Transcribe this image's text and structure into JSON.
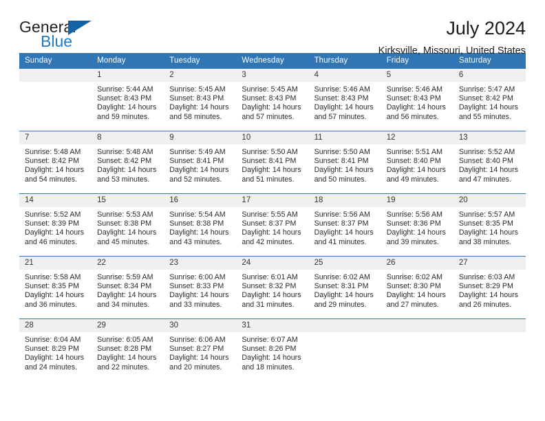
{
  "brand": {
    "name_part1": "General",
    "name_part2": "Blue",
    "accent_color": "#1e7bc4",
    "triangle_color": "#1464a5"
  },
  "header": {
    "title": "July 2024",
    "subtitle": "Kirksville, Missouri, United States"
  },
  "calendar": {
    "header_bg": "#3075b4",
    "daynum_bg": "#f0f0f0",
    "weekday_headers": [
      "Sunday",
      "Monday",
      "Tuesday",
      "Wednesday",
      "Thursday",
      "Friday",
      "Saturday"
    ],
    "labels": {
      "sunrise": "Sunrise:",
      "sunset": "Sunset:",
      "daylight": "Daylight:"
    },
    "weeks": [
      [
        {
          "day": "",
          "blank": true,
          "sunrise": "",
          "sunset": "",
          "daylight_line1": "",
          "daylight_line2": ""
        },
        {
          "day": "1",
          "sunrise": "Sunrise: 5:44 AM",
          "sunset": "Sunset: 8:43 PM",
          "daylight_line1": "Daylight: 14 hours",
          "daylight_line2": "and 59 minutes."
        },
        {
          "day": "2",
          "sunrise": "Sunrise: 5:45 AM",
          "sunset": "Sunset: 8:43 PM",
          "daylight_line1": "Daylight: 14 hours",
          "daylight_line2": "and 58 minutes."
        },
        {
          "day": "3",
          "sunrise": "Sunrise: 5:45 AM",
          "sunset": "Sunset: 8:43 PM",
          "daylight_line1": "Daylight: 14 hours",
          "daylight_line2": "and 57 minutes."
        },
        {
          "day": "4",
          "sunrise": "Sunrise: 5:46 AM",
          "sunset": "Sunset: 8:43 PM",
          "daylight_line1": "Daylight: 14 hours",
          "daylight_line2": "and 57 minutes."
        },
        {
          "day": "5",
          "sunrise": "Sunrise: 5:46 AM",
          "sunset": "Sunset: 8:43 PM",
          "daylight_line1": "Daylight: 14 hours",
          "daylight_line2": "and 56 minutes."
        },
        {
          "day": "6",
          "sunrise": "Sunrise: 5:47 AM",
          "sunset": "Sunset: 8:42 PM",
          "daylight_line1": "Daylight: 14 hours",
          "daylight_line2": "and 55 minutes."
        }
      ],
      [
        {
          "day": "7",
          "sunrise": "Sunrise: 5:48 AM",
          "sunset": "Sunset: 8:42 PM",
          "daylight_line1": "Daylight: 14 hours",
          "daylight_line2": "and 54 minutes."
        },
        {
          "day": "8",
          "sunrise": "Sunrise: 5:48 AM",
          "sunset": "Sunset: 8:42 PM",
          "daylight_line1": "Daylight: 14 hours",
          "daylight_line2": "and 53 minutes."
        },
        {
          "day": "9",
          "sunrise": "Sunrise: 5:49 AM",
          "sunset": "Sunset: 8:41 PM",
          "daylight_line1": "Daylight: 14 hours",
          "daylight_line2": "and 52 minutes."
        },
        {
          "day": "10",
          "sunrise": "Sunrise: 5:50 AM",
          "sunset": "Sunset: 8:41 PM",
          "daylight_line1": "Daylight: 14 hours",
          "daylight_line2": "and 51 minutes."
        },
        {
          "day": "11",
          "sunrise": "Sunrise: 5:50 AM",
          "sunset": "Sunset: 8:41 PM",
          "daylight_line1": "Daylight: 14 hours",
          "daylight_line2": "and 50 minutes."
        },
        {
          "day": "12",
          "sunrise": "Sunrise: 5:51 AM",
          "sunset": "Sunset: 8:40 PM",
          "daylight_line1": "Daylight: 14 hours",
          "daylight_line2": "and 49 minutes."
        },
        {
          "day": "13",
          "sunrise": "Sunrise: 5:52 AM",
          "sunset": "Sunset: 8:40 PM",
          "daylight_line1": "Daylight: 14 hours",
          "daylight_line2": "and 47 minutes."
        }
      ],
      [
        {
          "day": "14",
          "sunrise": "Sunrise: 5:52 AM",
          "sunset": "Sunset: 8:39 PM",
          "daylight_line1": "Daylight: 14 hours",
          "daylight_line2": "and 46 minutes."
        },
        {
          "day": "15",
          "sunrise": "Sunrise: 5:53 AM",
          "sunset": "Sunset: 8:38 PM",
          "daylight_line1": "Daylight: 14 hours",
          "daylight_line2": "and 45 minutes."
        },
        {
          "day": "16",
          "sunrise": "Sunrise: 5:54 AM",
          "sunset": "Sunset: 8:38 PM",
          "daylight_line1": "Daylight: 14 hours",
          "daylight_line2": "and 43 minutes."
        },
        {
          "day": "17",
          "sunrise": "Sunrise: 5:55 AM",
          "sunset": "Sunset: 8:37 PM",
          "daylight_line1": "Daylight: 14 hours",
          "daylight_line2": "and 42 minutes."
        },
        {
          "day": "18",
          "sunrise": "Sunrise: 5:56 AM",
          "sunset": "Sunset: 8:37 PM",
          "daylight_line1": "Daylight: 14 hours",
          "daylight_line2": "and 41 minutes."
        },
        {
          "day": "19",
          "sunrise": "Sunrise: 5:56 AM",
          "sunset": "Sunset: 8:36 PM",
          "daylight_line1": "Daylight: 14 hours",
          "daylight_line2": "and 39 minutes."
        },
        {
          "day": "20",
          "sunrise": "Sunrise: 5:57 AM",
          "sunset": "Sunset: 8:35 PM",
          "daylight_line1": "Daylight: 14 hours",
          "daylight_line2": "and 38 minutes."
        }
      ],
      [
        {
          "day": "21",
          "sunrise": "Sunrise: 5:58 AM",
          "sunset": "Sunset: 8:35 PM",
          "daylight_line1": "Daylight: 14 hours",
          "daylight_line2": "and 36 minutes."
        },
        {
          "day": "22",
          "sunrise": "Sunrise: 5:59 AM",
          "sunset": "Sunset: 8:34 PM",
          "daylight_line1": "Daylight: 14 hours",
          "daylight_line2": "and 34 minutes."
        },
        {
          "day": "23",
          "sunrise": "Sunrise: 6:00 AM",
          "sunset": "Sunset: 8:33 PM",
          "daylight_line1": "Daylight: 14 hours",
          "daylight_line2": "and 33 minutes."
        },
        {
          "day": "24",
          "sunrise": "Sunrise: 6:01 AM",
          "sunset": "Sunset: 8:32 PM",
          "daylight_line1": "Daylight: 14 hours",
          "daylight_line2": "and 31 minutes."
        },
        {
          "day": "25",
          "sunrise": "Sunrise: 6:02 AM",
          "sunset": "Sunset: 8:31 PM",
          "daylight_line1": "Daylight: 14 hours",
          "daylight_line2": "and 29 minutes."
        },
        {
          "day": "26",
          "sunrise": "Sunrise: 6:02 AM",
          "sunset": "Sunset: 8:30 PM",
          "daylight_line1": "Daylight: 14 hours",
          "daylight_line2": "and 27 minutes."
        },
        {
          "day": "27",
          "sunrise": "Sunrise: 6:03 AM",
          "sunset": "Sunset: 8:29 PM",
          "daylight_line1": "Daylight: 14 hours",
          "daylight_line2": "and 26 minutes."
        }
      ],
      [
        {
          "day": "28",
          "sunrise": "Sunrise: 6:04 AM",
          "sunset": "Sunset: 8:29 PM",
          "daylight_line1": "Daylight: 14 hours",
          "daylight_line2": "and 24 minutes."
        },
        {
          "day": "29",
          "sunrise": "Sunrise: 6:05 AM",
          "sunset": "Sunset: 8:28 PM",
          "daylight_line1": "Daylight: 14 hours",
          "daylight_line2": "and 22 minutes."
        },
        {
          "day": "30",
          "sunrise": "Sunrise: 6:06 AM",
          "sunset": "Sunset: 8:27 PM",
          "daylight_line1": "Daylight: 14 hours",
          "daylight_line2": "and 20 minutes."
        },
        {
          "day": "31",
          "sunrise": "Sunrise: 6:07 AM",
          "sunset": "Sunset: 8:26 PM",
          "daylight_line1": "Daylight: 14 hours",
          "daylight_line2": "and 18 minutes."
        },
        {
          "day": "",
          "blank": true,
          "sunrise": "",
          "sunset": "",
          "daylight_line1": "",
          "daylight_line2": ""
        },
        {
          "day": "",
          "blank": true,
          "sunrise": "",
          "sunset": "",
          "daylight_line1": "",
          "daylight_line2": ""
        },
        {
          "day": "",
          "blank": true,
          "sunrise": "",
          "sunset": "",
          "daylight_line1": "",
          "daylight_line2": ""
        }
      ]
    ]
  }
}
